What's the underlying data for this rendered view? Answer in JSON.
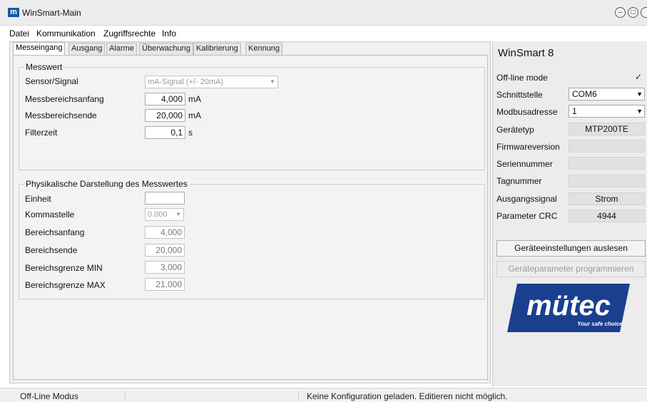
{
  "window": {
    "title": "WinSmart-Main",
    "icon": "m-logo-icon"
  },
  "menu": [
    "Datei",
    "Kommunikation",
    "Zugriffsrechte",
    "Info"
  ],
  "tabs": [
    {
      "label": "Messeingang",
      "active": true
    },
    {
      "label": "Ausgang"
    },
    {
      "label": "Alarme"
    },
    {
      "label": "Überwachung"
    },
    {
      "label": "Kalibrierung"
    },
    {
      "label": "Kennung"
    }
  ],
  "messwert": {
    "title": "Messwert",
    "sensor_label": "Sensor/Signal",
    "sensor_value": "mA-Signal (+/- 20mA)",
    "anfang_label": "Messbereichsanfang",
    "anfang_value": "4,000",
    "anfang_unit": "mA",
    "ende_label": "Messbereichsende",
    "ende_value": "20,000",
    "ende_unit": "mA",
    "filter_label": "Filterzeit",
    "filter_value": "0,1",
    "filter_unit": "s"
  },
  "physik": {
    "title": "Physikalische Darstellung des Messwertes",
    "einheit_label": "Einheit",
    "einheit_value": "",
    "komma_label": "Kommastelle",
    "komma_value": "0.000",
    "banfang_label": "Bereichsanfang",
    "banfang_value": "4,000",
    "bende_label": "Bereichsende",
    "bende_value": "20,000",
    "gmin_label": "Bereichsgrenze MIN",
    "gmin_value": "3,000",
    "gmax_label": "Bereichsgrenze MAX",
    "gmax_value": "21,000"
  },
  "right": {
    "title": "WinSmart 8",
    "offline_label": "Off-line mode",
    "offline_checked": true,
    "schnittstelle_label": "Schnittstelle",
    "schnittstelle_value": "COM6",
    "modbus_label": "Modbusadresse",
    "modbus_value": "1",
    "geraetetyp_label": "Gerätetyp",
    "geraetetyp_value": "MTP200TE",
    "firmware_label": "Firmwareversion",
    "firmware_value": "",
    "serien_label": "Seriennummer",
    "serien_value": "",
    "tag_label": "Tagnummer",
    "tag_value": "",
    "ausgang_label": "Ausgangssignal",
    "ausgang_value": "Strom",
    "crc_label": "Parameter CRC",
    "crc_value": "4944",
    "btn_read": "Geräteeinstellungen auslesen",
    "btn_program": "Geräteparameter programmieren"
  },
  "logo": {
    "brand": "mütec",
    "tagline": "Your safe choice",
    "color": "#1b3f8f"
  },
  "status": {
    "mode": "Off-Line Modus",
    "message": "Keine Konfiguration geladen. Editieren nicht möglich."
  }
}
